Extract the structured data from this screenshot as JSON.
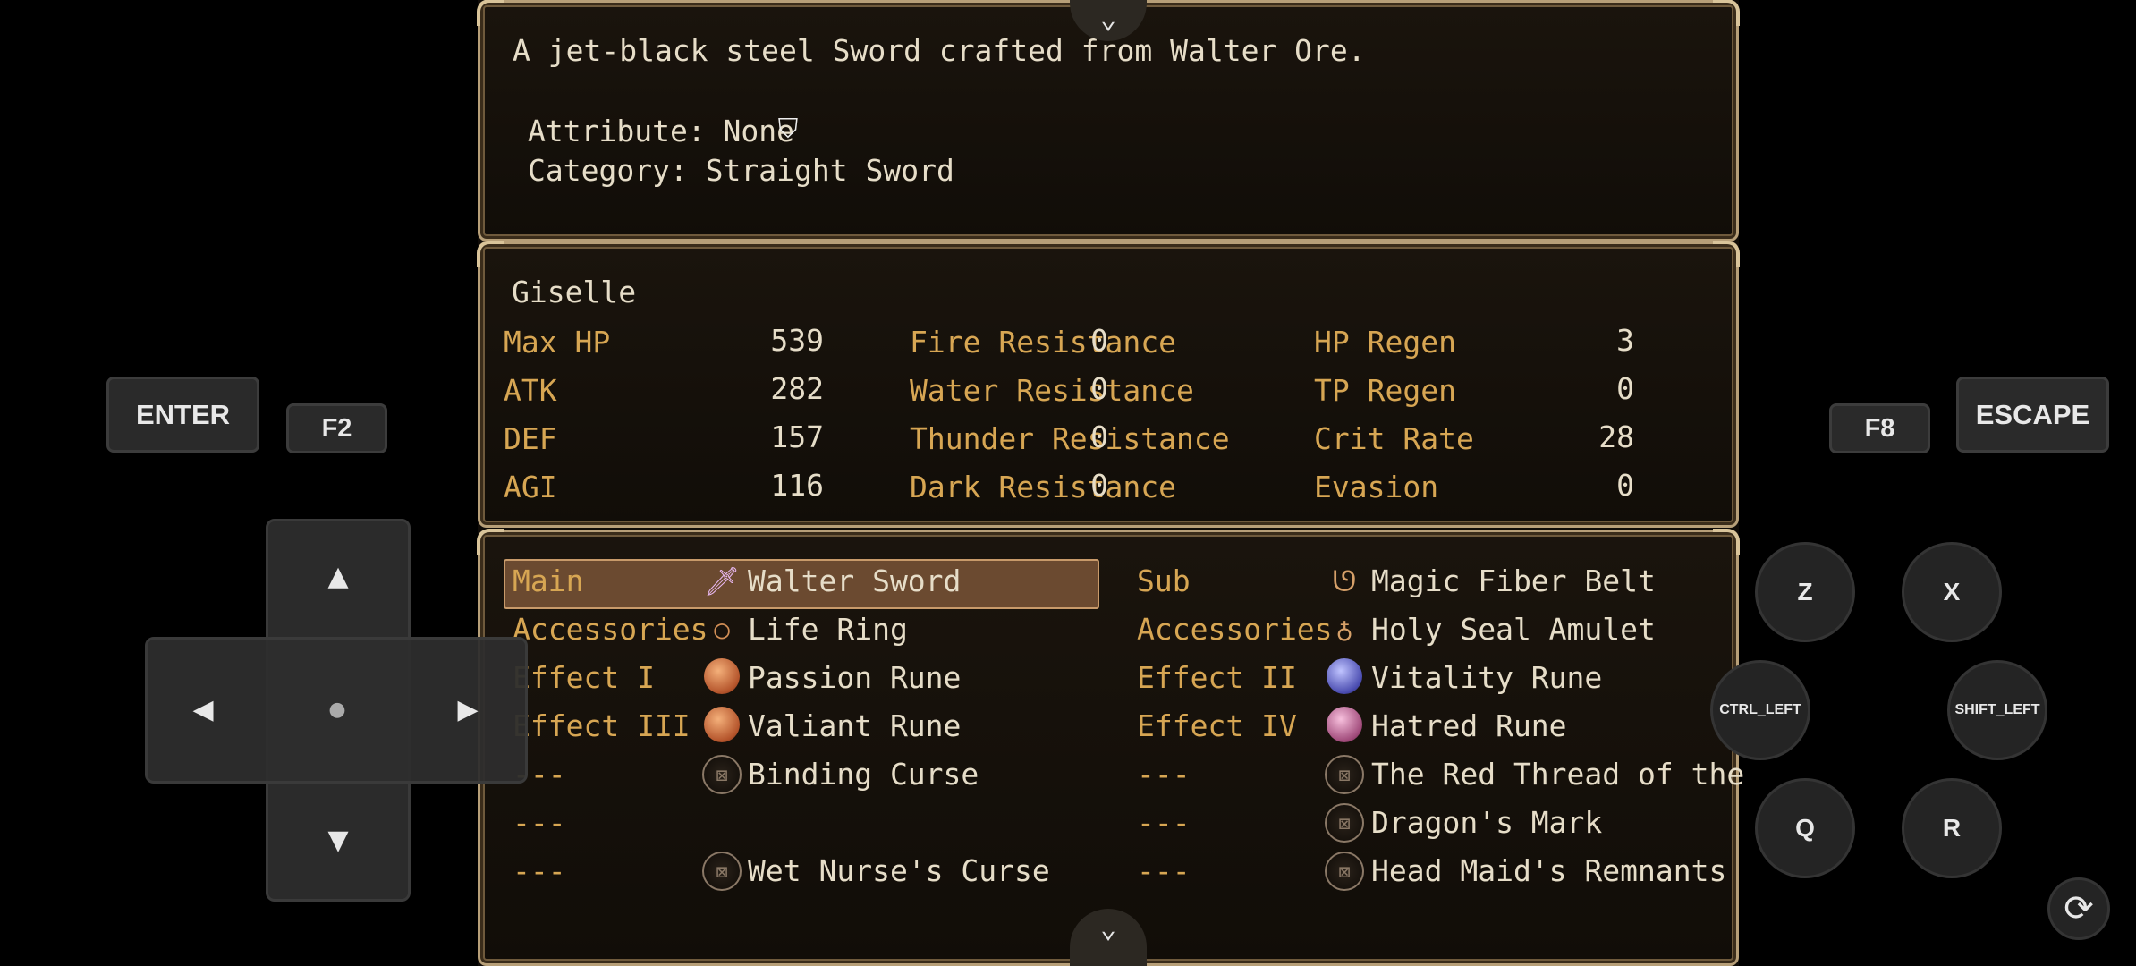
{
  "description": {
    "line1": "A jet-black steel Sword crafted from Walter Ore.",
    "attribute": "Attribute: None",
    "category": "Category: Straight Sword"
  },
  "character": {
    "name": "Giselle",
    "stats_col1": [
      {
        "label": "Max HP",
        "value": "539"
      },
      {
        "label": "ATK",
        "value": "282"
      },
      {
        "label": "DEF",
        "value": "157"
      },
      {
        "label": "AGI",
        "value": "116"
      }
    ],
    "stats_col2": [
      {
        "label": "Fire Resistance",
        "value": "0"
      },
      {
        "label": "Water Resistance",
        "value": "0"
      },
      {
        "label": "Thunder Resistance",
        "value": "0"
      },
      {
        "label": "Dark Resistance",
        "value": "0"
      }
    ],
    "stats_col3": [
      {
        "label": "HP Regen",
        "value": "3"
      },
      {
        "label": "TP Regen",
        "value": "0"
      },
      {
        "label": "Crit Rate",
        "value": "28"
      },
      {
        "label": "Evasion",
        "value": "0"
      }
    ]
  },
  "equipment": {
    "left": [
      {
        "slot": "Main",
        "item": "Walter Sword",
        "icon": "sword-icon"
      },
      {
        "slot": "Accessories",
        "item": "Life Ring",
        "icon": "ring-icon"
      },
      {
        "slot": "Effect I",
        "item": "Passion Rune",
        "icon": "rune-icon"
      },
      {
        "slot": "Effect III",
        "item": "Valiant Rune",
        "icon": "rune-icon"
      },
      {
        "slot": "---",
        "item": "Binding Curse",
        "icon": "curse-seal-icon"
      },
      {
        "slot": "---",
        "item": "",
        "icon": ""
      },
      {
        "slot": "---",
        "item": "Wet Nurse's Curse",
        "icon": "curse-seal-icon"
      }
    ],
    "right": [
      {
        "slot": "Sub",
        "item": "Magic Fiber Belt",
        "icon": "belt-icon"
      },
      {
        "slot": "Accessories",
        "item": "Holy Seal Amulet",
        "icon": "amulet-icon"
      },
      {
        "slot": "Effect II",
        "item": "Vitality Rune",
        "icon": "rune-icon"
      },
      {
        "slot": "Effect IV",
        "item": "Hatred Rune",
        "icon": "rune-icon"
      },
      {
        "slot": "---",
        "item": "The Red Thread of the",
        "icon": "curse-seal-icon"
      },
      {
        "slot": "---",
        "item": "Dragon's Mark",
        "icon": "curse-seal-icon"
      },
      {
        "slot": "---",
        "item": "Head Maid's Remnants",
        "icon": "curse-seal-icon"
      }
    ]
  },
  "controls": {
    "enter": "ENTER",
    "f2": "F2",
    "f8": "F8",
    "escape": "ESCAPE",
    "z": "Z",
    "x": "X",
    "ctrl_left": "CTRL_LEFT",
    "shift_left": "SHIFT_LEFT",
    "q": "Q",
    "r": "R"
  },
  "colors": {
    "label_gold": "#d7a653",
    "text": "#e6ddc8",
    "selection": "#6b4a30"
  }
}
